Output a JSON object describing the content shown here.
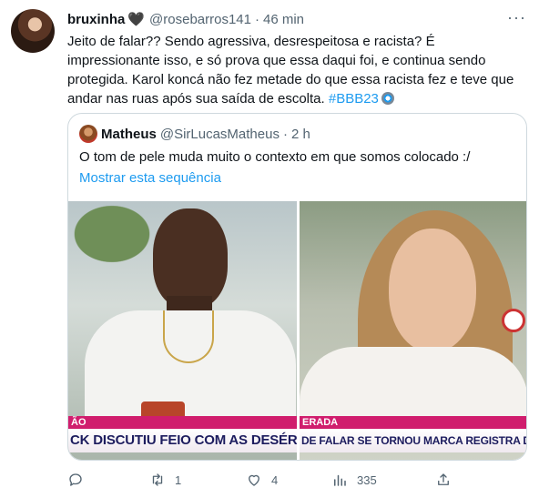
{
  "tweet": {
    "display_name": "bruxinha",
    "handle": "@rosebarros141",
    "separator": "·",
    "time": "46 min",
    "more_label": "···",
    "text_main": "Jeito de falar?? Sendo agressiva, desrespeitosa e racista? É impressionante isso, e só prova que essa daqui foi, e continua sendo protegida. Karol koncá não fez metade do que essa racista fez e teve que andar nas ruas após sua saída de escolta.",
    "hashtag": "#BBB23"
  },
  "quote": {
    "display_name": "Matheus",
    "handle": "@SirLucasMatheus",
    "separator": "·",
    "time": "2 h",
    "text": "O tom de pele muda muito o contexto em que somos colocado :/",
    "show_thread_label": "Mostrar esta sequência",
    "media": {
      "left_tag": "ÃO",
      "left_ticker": "CK DISCUTIU FEIO COM AS DESÉRTICA",
      "right_tag": "ERADA",
      "right_ticker": "DE FALAR SE TORNOU MARCA REGISTRA DA BRUNA"
    }
  },
  "actions": {
    "reply_count": "",
    "retweet_count": "1",
    "like_count": "4",
    "views_count": "335"
  },
  "colors": {
    "accent": "#1d9bf0",
    "secondary_text": "#536471",
    "border": "#cfd9de",
    "tv_pink": "#d01d6d"
  },
  "icons": [
    "heart-icon",
    "more-icon",
    "bbb-eye-icon",
    "reply-icon",
    "retweet-icon",
    "like-icon",
    "views-icon",
    "share-icon"
  ]
}
